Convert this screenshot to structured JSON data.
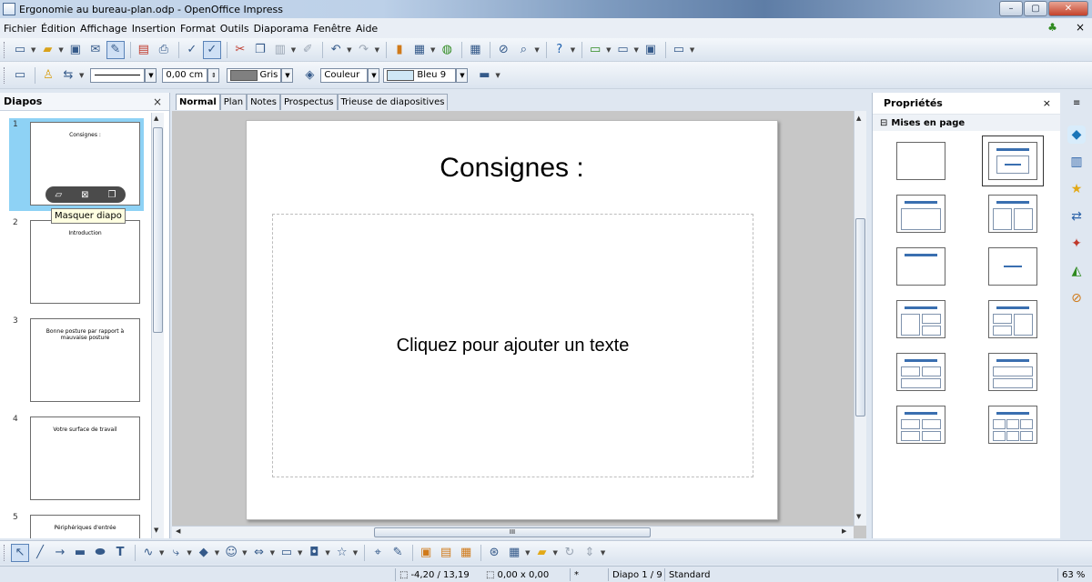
{
  "window": {
    "title": "Ergonomie au bureau-plan.odp - OpenOffice Impress",
    "minimize": "–",
    "restore": "▢",
    "close": "✕"
  },
  "menu": {
    "items": [
      "Fichier",
      "Édition",
      "Affichage",
      "Insertion",
      "Format",
      "Outils",
      "Diaporama",
      "Fenêtre",
      "Aide"
    ],
    "right_icon": "♣",
    "right_close": "×"
  },
  "line_toolbar": {
    "width_value": "0,00 cm",
    "fill_color_name": "Gris",
    "fill_swatch": "#808080",
    "area_type": "Couleur",
    "area_color_name": "Bleu 9",
    "area_swatch": "#cfe7f5"
  },
  "slides_panel": {
    "title": "Diapos",
    "close": "×",
    "tooltip": "Masquer diapo",
    "slides": [
      {
        "number": "1",
        "title": "Consignes :"
      },
      {
        "number": "2",
        "title": "Introduction"
      },
      {
        "number": "3",
        "title": "Bonne posture par rapport à mauvaise posture"
      },
      {
        "number": "4",
        "title": "Votre surface de travail"
      },
      {
        "number": "5",
        "title": "Périphériques d'entrée"
      }
    ]
  },
  "view_tabs": [
    "Normal",
    "Plan",
    "Notes",
    "Prospectus",
    "Trieuse de diapositives"
  ],
  "slide": {
    "title": "Consignes :",
    "placeholder": "Cliquez pour ajouter un texte"
  },
  "hscroll_label": "III",
  "properties": {
    "title": "Propriétés",
    "close": "×",
    "menu": "≡",
    "section_toggle": "⊟",
    "section": "Mises en page"
  },
  "status": {
    "position_icon": "⬚",
    "position": "-4,20 / 13,19",
    "size_icon": "⬚",
    "size": "0,00 x 0,00",
    "modified": "*",
    "slide": "Diapo 1 / 9",
    "master": "Standard",
    "zoom": "63 %"
  }
}
